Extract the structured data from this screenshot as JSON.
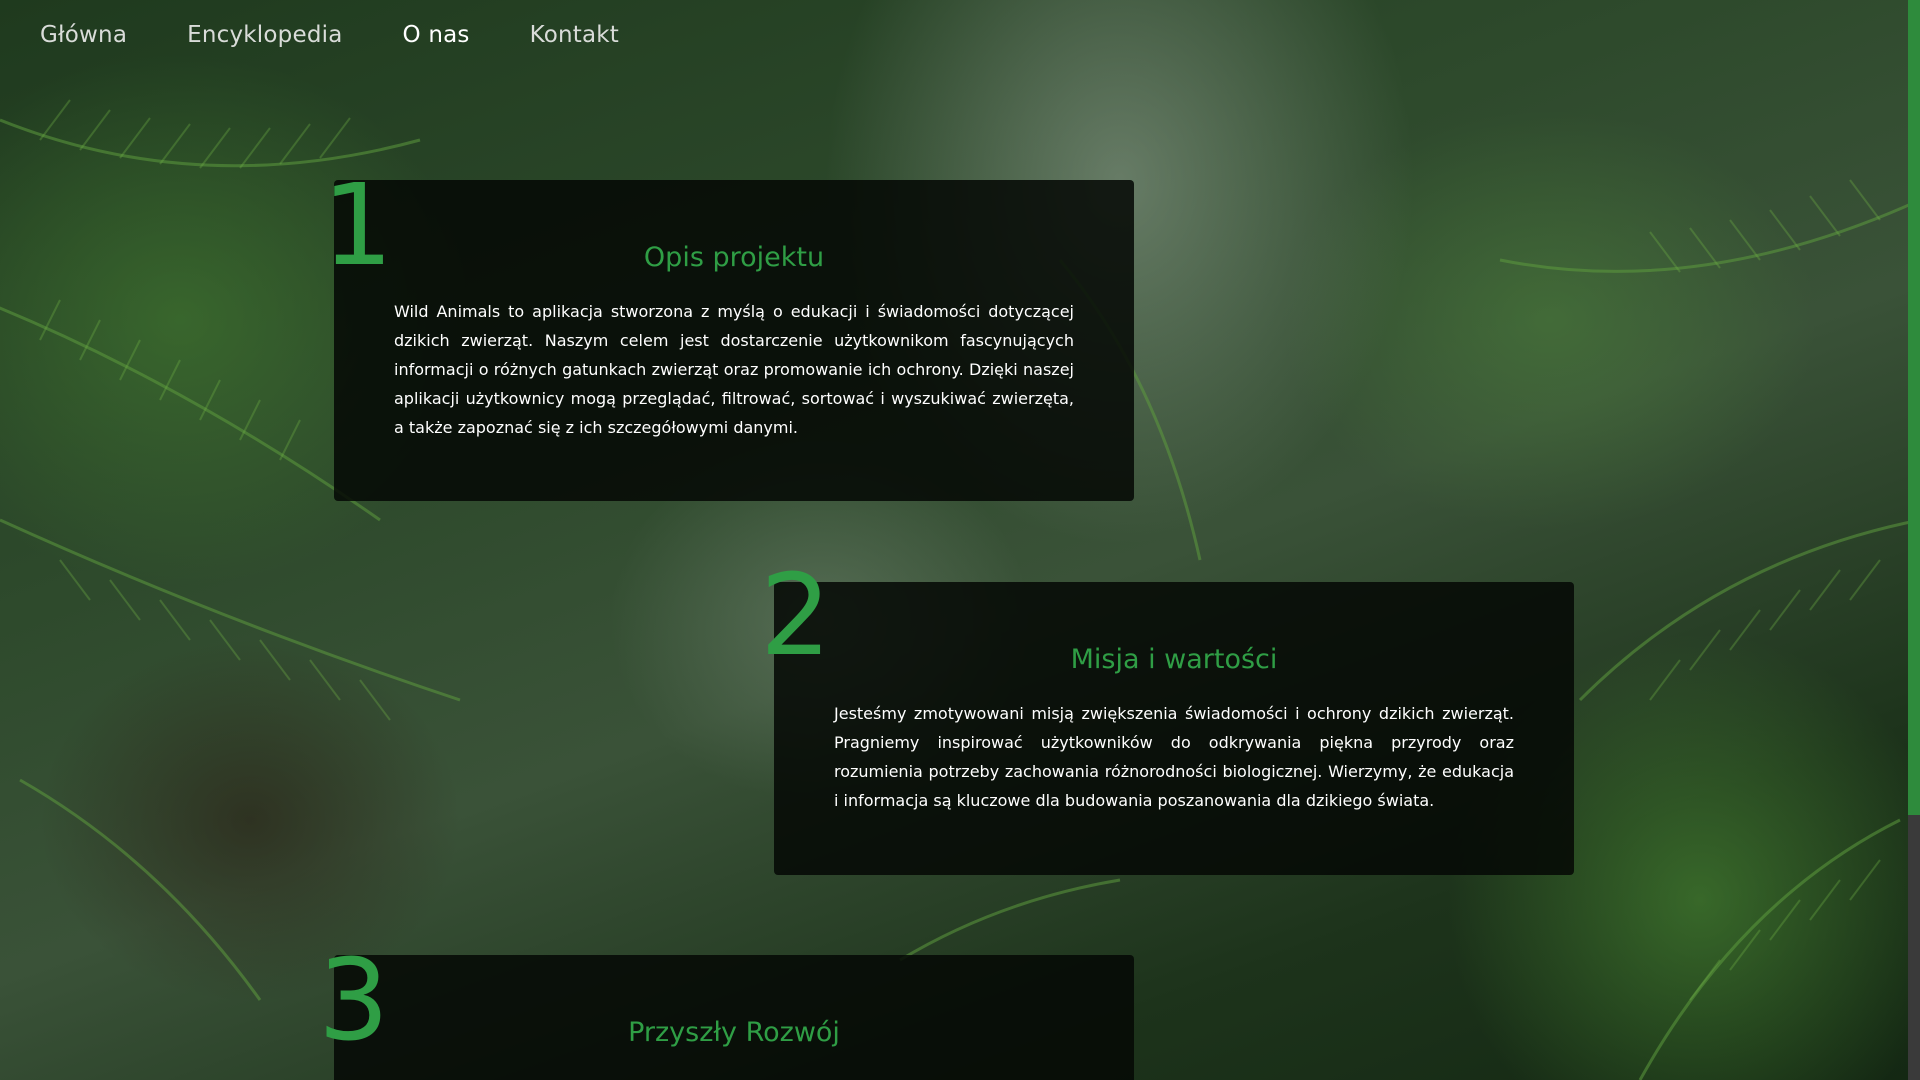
{
  "nav": {
    "items": [
      {
        "label": "Główna",
        "active": false
      },
      {
        "label": "Encyklopedia",
        "active": false
      },
      {
        "label": "O nas",
        "active": true
      },
      {
        "label": "Kontakt",
        "active": false
      }
    ]
  },
  "sections": [
    {
      "number": "1",
      "title": "Opis projektu",
      "text": "Wild Animals to aplikacja stworzona z myślą o edukacji i świadomości dotyczącej dzikich zwierząt. Naszym celem jest dostarczenie użytkownikom fascynujących informacji o różnych gatunkach zwierząt oraz promowanie ich ochrony. Dzięki naszej aplikacji użytkownicy mogą przeglądać, filtrować, sortować i wyszukiwać zwierzęta, a także zapoznać się z ich szczegółowymi danymi."
    },
    {
      "number": "2",
      "title": "Misja i wartości",
      "text": "Jesteśmy zmotywowani misją zwiększenia świadomości i ochrony dzikich zwierząt. Pragniemy inspirować użytkowników do odkrywania piękna przyrody oraz rozumienia potrzeby zachowania różnorodności biologicznej. Wierzymy, że edukacja i informacja są kluczowe dla budowania poszanowania dla dzikiego świata."
    },
    {
      "number": "3",
      "title": "Przyszły Rozwój"
    }
  ],
  "colors": {
    "accent": "#2f9e45",
    "card_bg": "rgba(5,8,5,0.86)",
    "nav_text": "#d9dcd9",
    "scrollbar_thumb": "#2e8b3c"
  },
  "background": "fern-forest-photo"
}
